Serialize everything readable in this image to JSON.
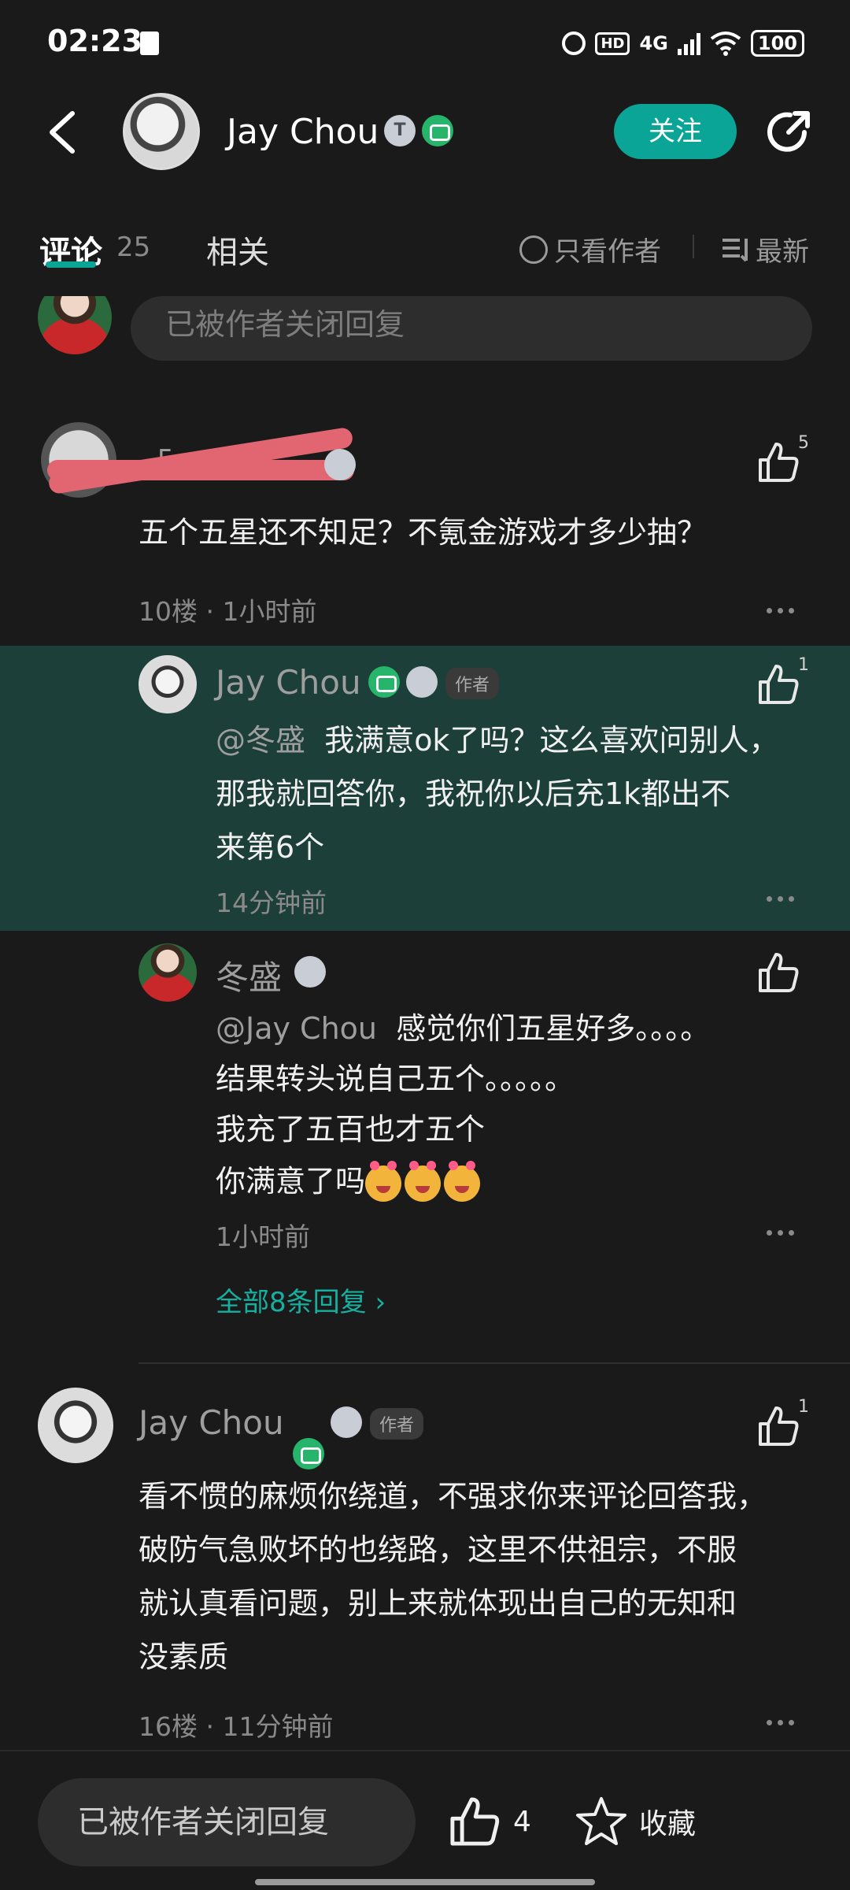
{
  "status_bar": {
    "time": "02:23",
    "hd_label": "HD",
    "network": "4G",
    "battery": "100"
  },
  "header": {
    "author_name": "Jay Chou",
    "badge_t": "T",
    "follow_label": "关注"
  },
  "tabs": {
    "comments_label": "评论",
    "comments_count": "25",
    "related_label": "相关"
  },
  "filters": {
    "only_author_label": "只看作者",
    "sort_label": "最新"
  },
  "reply_closed_text": "已被作者关闭回复",
  "comments": [
    {
      "username_partial": "「",
      "text": "五个五星还不知足？不氪金游戏才多少抽？",
      "likes": "5",
      "meta": "10楼 · 1小时前",
      "replies": [
        {
          "username": "Jay Chou",
          "author_tag": "作者",
          "likes": "1",
          "mention": "@冬盛",
          "text_line1": "我满意ok了吗？这么喜欢问别人，",
          "text_line2": "那我就回答你，我祝你以后充1k都出不",
          "text_line3": "来第6个",
          "meta": "14分钟前"
        },
        {
          "username": "冬盛",
          "mention": "@Jay Chou",
          "text_line1": "感觉你们五星好多。。。。",
          "text_line2": "结果转头说自己五个。。。。。",
          "text_line3": "我充了五百也才五个",
          "text_line4": "你满意了吗",
          "meta": "1小时前"
        }
      ],
      "view_all_label": "全部8条回复 ›"
    },
    {
      "username": "Jay Chou",
      "author_tag": "作者",
      "likes": "1",
      "text_line1": "看不惯的麻烦你绕道，不强求你来评论回答我，",
      "text_line2": "破防气急败坏的也绕路，这里不供祖宗，不服",
      "text_line3": "就认真看问题，别上来就体现出自己的无知和",
      "text_line4": "没素质",
      "meta": "16楼 · 11分钟前"
    }
  ],
  "bottom_bar": {
    "reply_placeholder": "已被作者关闭回复",
    "like_count": "4",
    "favorite_label": "收藏"
  },
  "colors": {
    "accent": "#0aa596",
    "highlight": "#1d3f39",
    "background": "#1a1a1a"
  }
}
